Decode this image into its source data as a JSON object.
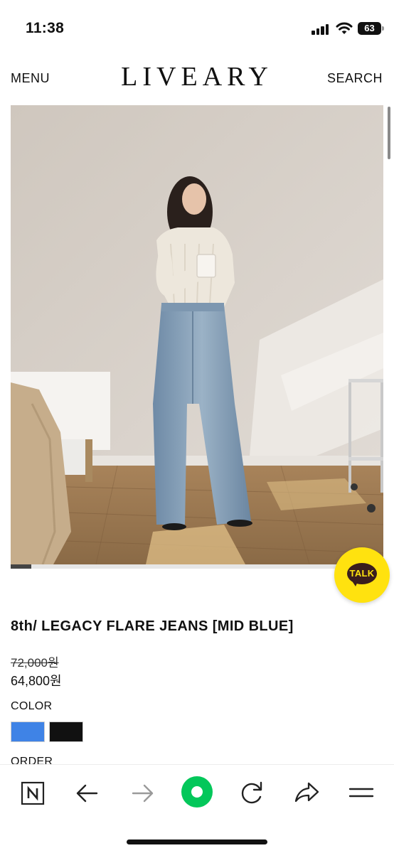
{
  "status_bar": {
    "time": "11:38",
    "battery": "63",
    "icons": [
      "signal-icon",
      "wifi-icon",
      "battery-icon"
    ]
  },
  "header": {
    "menu_label": "MENU",
    "brand": "LIVEARY",
    "search_label": "SEARCH"
  },
  "gallery": {
    "image_subject": "model wearing flare jeans and white cable knit sweater holding a mug",
    "slide_progress": 0.055
  },
  "talk_button": {
    "label": "TALK",
    "color": "#ffe20f"
  },
  "product": {
    "title": "8th/ LEGACY FLARE JEANS [MID BLUE]",
    "price_original": "72,000원",
    "price_sale": "64,800원",
    "color_label": "COLOR",
    "colors": [
      {
        "name": "blue",
        "hex": "#3f83e6"
      },
      {
        "name": "black",
        "hex": "#111111"
      }
    ],
    "order_label": "ORDER"
  },
  "browser_toolbar": {
    "buttons": [
      "naver-home-icon",
      "back-arrow-icon",
      "forward-arrow-icon",
      "green-dot-icon",
      "refresh-icon",
      "share-icon",
      "menu-icon"
    ],
    "accent": "#03c75a"
  }
}
